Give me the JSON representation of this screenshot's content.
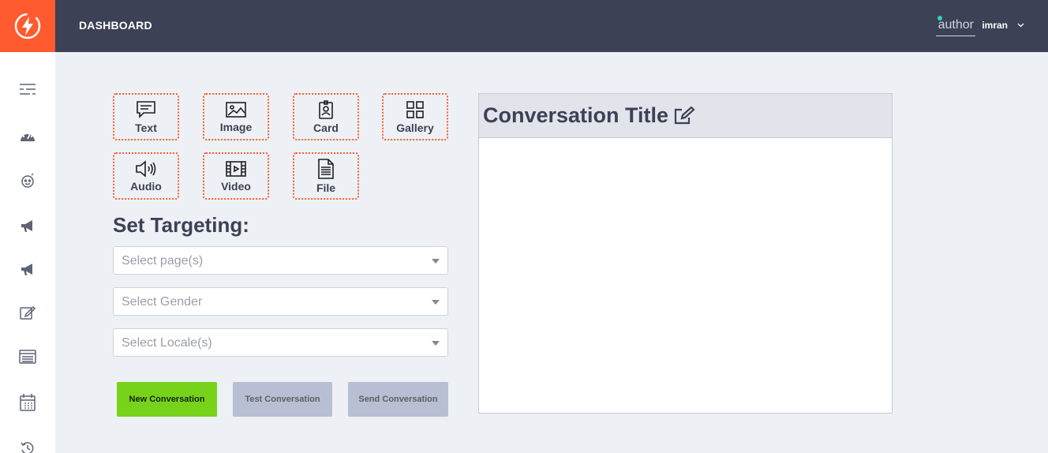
{
  "header": {
    "title": "DASHBOARD",
    "avatar_alt": "author",
    "username": "imran"
  },
  "sidebar": {
    "items": [
      "list-icon",
      "gauge-icon",
      "robot-icon",
      "megaphone-icon",
      "megaphone-icon",
      "edit-icon",
      "table-icon",
      "calendar-icon",
      "history-icon"
    ]
  },
  "elements": {
    "text": "Text",
    "image": "Image",
    "card": "Card",
    "gallery": "Gallery",
    "audio": "Audio",
    "video": "Video",
    "file": "File"
  },
  "targeting": {
    "title": "Set Targeting:",
    "pages_placeholder": "Select page(s)",
    "gender_placeholder": "Select Gender",
    "locale_placeholder": "Select Locale(s)"
  },
  "actions": {
    "new": "New Conversation",
    "test": "Test Conversation",
    "send": "Send Conversation"
  },
  "conversation": {
    "title": "Conversation Title"
  },
  "colors": {
    "accent": "#ff5b2e",
    "topbar": "#3d4155",
    "primary_button": "#77d31a",
    "disabled_button": "#b8bed3"
  }
}
